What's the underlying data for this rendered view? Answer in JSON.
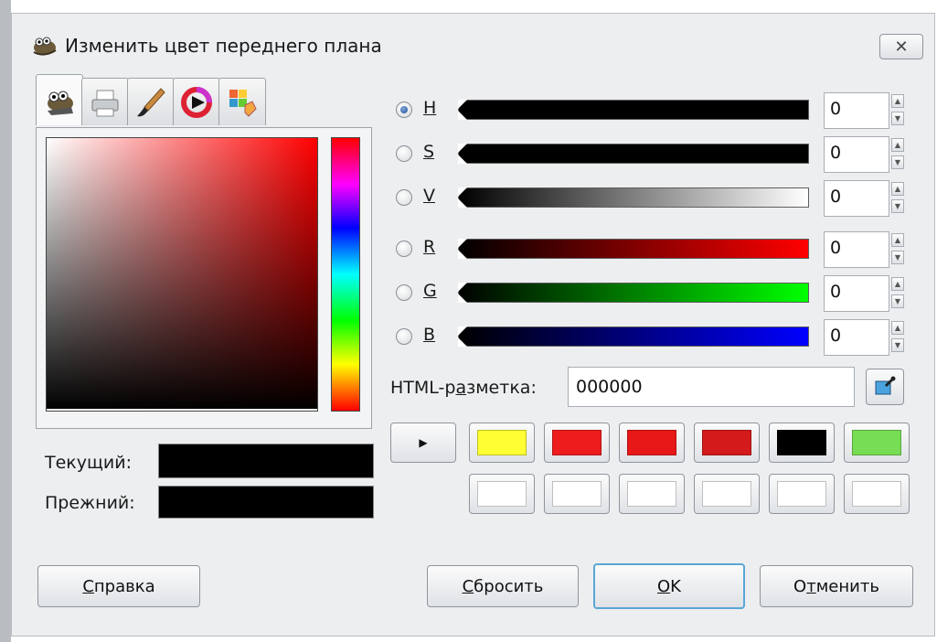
{
  "window": {
    "title": "Изменить цвет переднего плана",
    "close_glyph": "✕",
    "icon": "gimp-wilber-icon"
  },
  "tabs": [
    {
      "icon": "gimp-selector-icon",
      "active": true
    },
    {
      "icon": "cmyk-printer-icon",
      "active": false
    },
    {
      "icon": "watercolor-brush-icon",
      "active": false
    },
    {
      "icon": "color-wheel-icon",
      "active": false
    },
    {
      "icon": "palette-scales-icon",
      "active": false
    }
  ],
  "current_label": "Текущий:",
  "old_label": "Прежний:",
  "current_color": "#000000",
  "old_color": "#000000",
  "channels": [
    {
      "letter": "H",
      "value": "0",
      "checked": true,
      "gradient": [
        "#000000",
        "#000000"
      ]
    },
    {
      "letter": "S",
      "value": "0",
      "checked": false,
      "gradient": [
        "#000000",
        "#000000"
      ]
    },
    {
      "letter": "V",
      "value": "0",
      "checked": false,
      "gradient": [
        "#000000",
        "#ffffff"
      ]
    },
    {
      "letter": "R",
      "value": "0",
      "checked": false,
      "gradient": [
        "#000000",
        "#ff0000"
      ]
    },
    {
      "letter": "G",
      "value": "0",
      "checked": false,
      "gradient": [
        "#000000",
        "#00ff00"
      ]
    },
    {
      "letter": "B",
      "value": "0",
      "checked": false,
      "gradient": [
        "#000000",
        "#0000ff"
      ]
    }
  ],
  "html_notation": {
    "label_prefix": "HTML-р",
    "label_accel": "а",
    "label_suffix": "зметка:",
    "value": "000000"
  },
  "history_toggle_glyph": "▶",
  "history": [
    [
      "#ffff33",
      "#ee1c1c",
      "#e81818",
      "#d41a1a",
      "#000000",
      "#77dd55"
    ],
    [
      "#ffffff",
      "#ffffff",
      "#ffffff",
      "#ffffff",
      "#ffffff",
      "#ffffff"
    ]
  ],
  "buttons": {
    "help": {
      "accel": "С",
      "rest": "правка"
    },
    "reset": {
      "accel": "С",
      "rest": "бросить"
    },
    "ok": {
      "accel": "O",
      "rest": "K"
    },
    "cancel": {
      "pre": "О",
      "accel": "т",
      "rest": "менить"
    }
  }
}
